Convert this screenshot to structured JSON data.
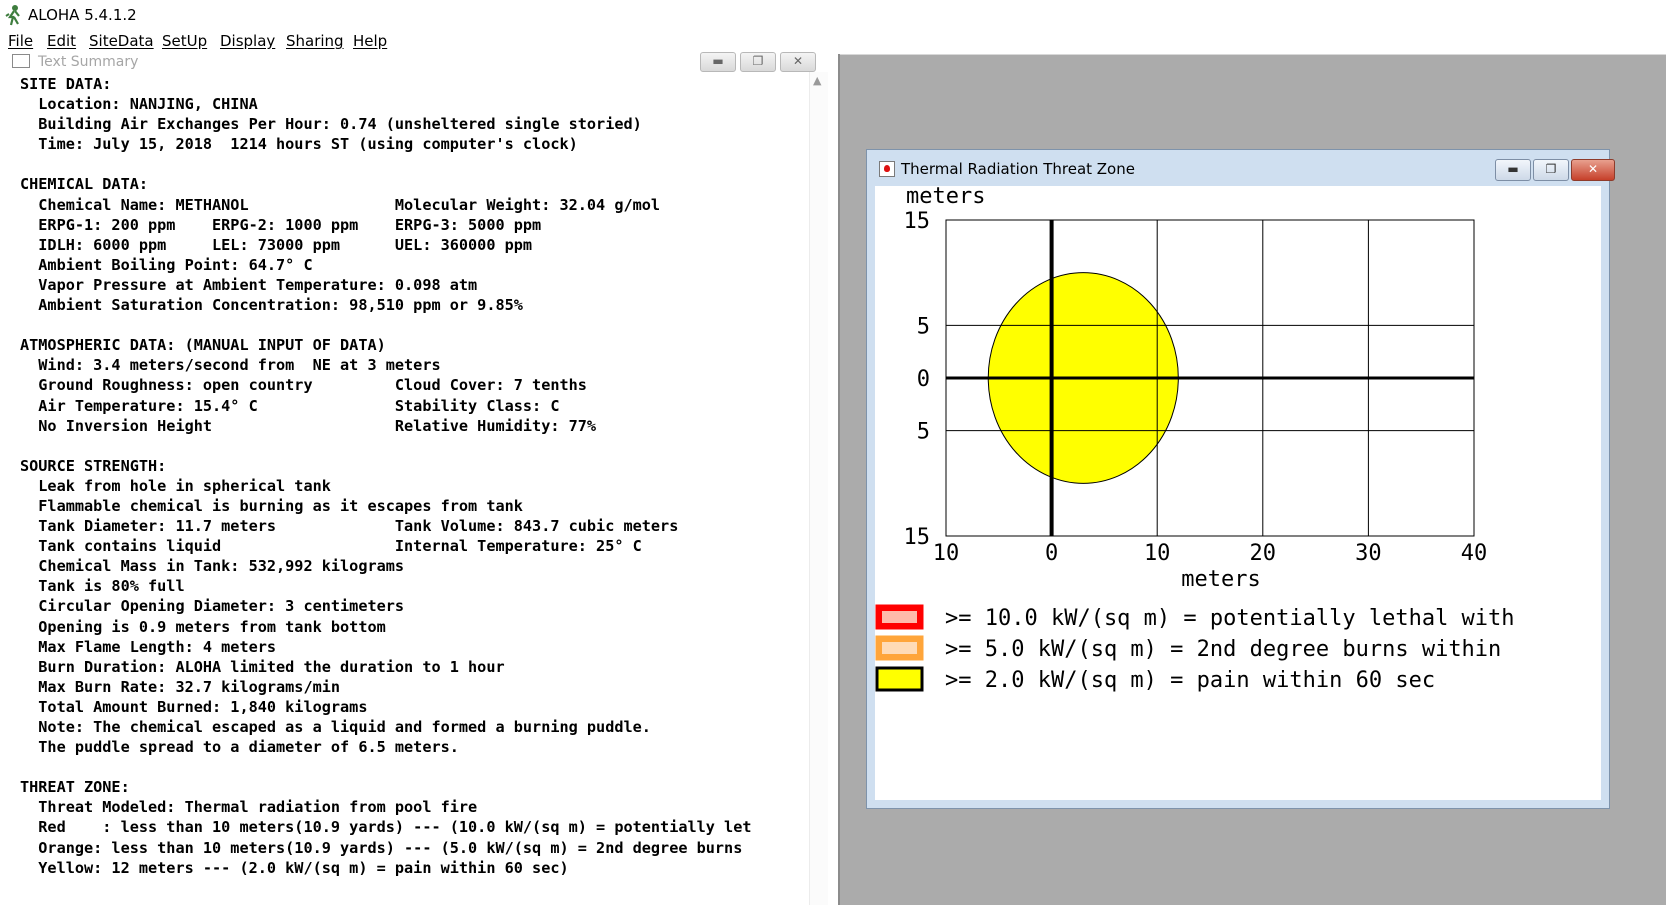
{
  "app": {
    "title": "ALOHA 5.4.1.2"
  },
  "menu": [
    "File",
    "Edit",
    "SiteData",
    "SetUp",
    "Display",
    "Sharing",
    "Help"
  ],
  "text_summary": {
    "title": "Text Summary",
    "lines": [
      "SITE DATA:",
      "  Location: NANJING, CHINA",
      "  Building Air Exchanges Per Hour: 0.74 (unsheltered single storied)",
      "  Time: July 15, 2018  1214 hours ST (using computer's clock)",
      "",
      "CHEMICAL DATA:",
      "  Chemical Name: METHANOL                Molecular Weight: 32.04 g/mol",
      "  ERPG-1: 200 ppm    ERPG-2: 1000 ppm    ERPG-3: 5000 ppm",
      "  IDLH: 6000 ppm     LEL: 73000 ppm      UEL: 360000 ppm",
      "  Ambient Boiling Point: 64.7° C",
      "  Vapor Pressure at Ambient Temperature: 0.098 atm",
      "  Ambient Saturation Concentration: 98,510 ppm or 9.85%",
      "",
      "ATMOSPHERIC DATA: (MANUAL INPUT OF DATA)",
      "  Wind: 3.4 meters/second from  NE at 3 meters",
      "  Ground Roughness: open country         Cloud Cover: 7 tenths",
      "  Air Temperature: 15.4° C               Stability Class: C",
      "  No Inversion Height                    Relative Humidity: 77%",
      "",
      "SOURCE STRENGTH:",
      "  Leak from hole in spherical tank",
      "  Flammable chemical is burning as it escapes from tank",
      "  Tank Diameter: 11.7 meters             Tank Volume: 843.7 cubic meters",
      "  Tank contains liquid                   Internal Temperature: 25° C",
      "  Chemical Mass in Tank: 532,992 kilograms",
      "  Tank is 80% full",
      "  Circular Opening Diameter: 3 centimeters",
      "  Opening is 0.9 meters from tank bottom",
      "  Max Flame Length: 4 meters",
      "  Burn Duration: ALOHA limited the duration to 1 hour",
      "  Max Burn Rate: 32.7 kilograms/min",
      "  Total Amount Burned: 1,840 kilograms",
      "  Note: The chemical escaped as a liquid and formed a burning puddle.",
      "  The puddle spread to a diameter of 6.5 meters.",
      "",
      "THREAT ZONE:",
      "  Threat Modeled: Thermal radiation from pool fire",
      "  Red    : less than 10 meters(10.9 yards) --- (10.0 kW/(sq m) = potentially let",
      "  Orange: less than 10 meters(10.9 yards) --- (5.0 kW/(sq m) = 2nd degree burns",
      "  Yellow: 12 meters --- (2.0 kW/(sq m) = pain within 60 sec)"
    ]
  },
  "threat_window": {
    "title": "Thermal Radiation Threat Zone",
    "colors": {
      "red": "#ff0000",
      "orange": "#ffa53a",
      "yellow": "#ffff00",
      "background": "#ffffff"
    },
    "legend": [
      {
        "text": ">= 10.0 kW/(sq m) = potentially lethal with",
        "color": "#ff0000"
      },
      {
        "text": ">= 5.0 kW/(sq m) = 2nd degree burns within",
        "color": "#ffa53a"
      },
      {
        "text": ">= 2.0 kW/(sq m) = pain within 60 sec",
        "color": "#ffff00"
      }
    ]
  },
  "chart_data": {
    "type": "area",
    "ylabel": "meters",
    "xlabel": "meters",
    "x_ticks": [
      "10",
      "0",
      "10",
      "20",
      "30",
      "40"
    ],
    "y_ticks": [
      "15",
      "5",
      "0",
      "5",
      "15"
    ],
    "xlim": [
      -10,
      40
    ],
    "ylim": [
      -15,
      15
    ],
    "grid": true,
    "zones": [
      {
        "name": "yellow",
        "threshold": "2.0 kW/(sq m)",
        "x_range": [
          -6,
          12
        ],
        "y_range": [
          -10,
          10
        ],
        "color": "#ffff00"
      }
    ]
  }
}
